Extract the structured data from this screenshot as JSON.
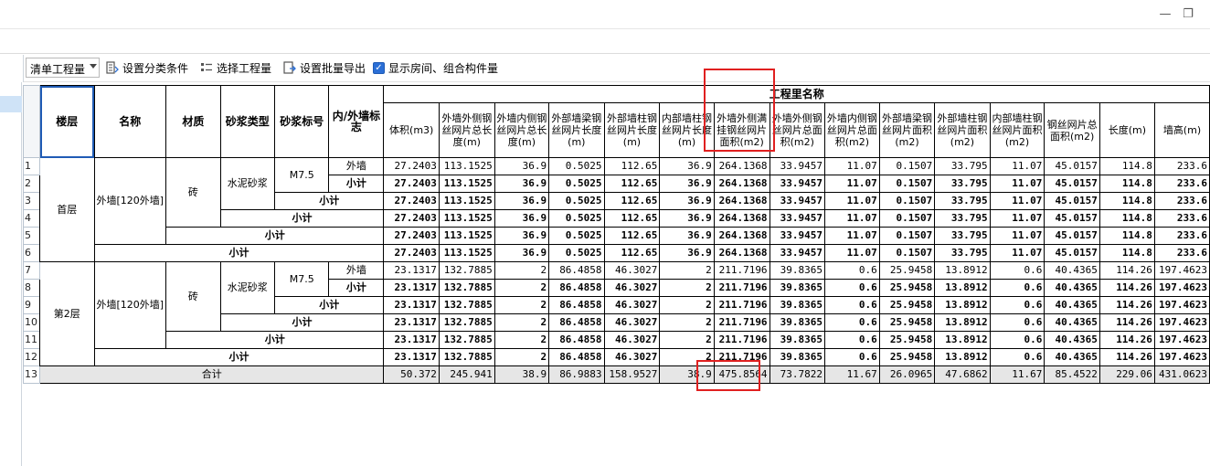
{
  "window": {
    "minimize_icon": "minimize-icon",
    "restore_icon": "restore-icon"
  },
  "toolbar": {
    "dropdown_value": "清单工程量",
    "group_label": "设置分类条件",
    "select_label": "选择工程量",
    "export_label": "设置批量导出",
    "show_label": "显示房间、组合构件量",
    "show_checked": true
  },
  "table": {
    "group_header": "工程里名称",
    "columns": {
      "floor": "楼层",
      "name": "名称",
      "material": "材质",
      "mortar_type": "砂浆类型",
      "mortar_grade": "砂浆标号",
      "inner_outer": "内/外墙标志",
      "volume": "体积(m3)",
      "c1": "外墙外侧钢丝网片总长度(m)",
      "c2": "外墙内侧钢丝网片总长度(m)",
      "c3": "外部墙梁钢丝网片长度(m)",
      "c4": "外部墙柱钢丝网片长度(m)",
      "c5": "内部墙柱钢丝网片长度(m)",
      "c6": "外墙外侧满挂钢丝网片面积(m2)",
      "c7": "外墙外侧钢丝网片总面积(m2)",
      "c8": "外墙内侧钢丝网片总面积(m2)",
      "c9": "外部墙梁钢丝网片面积(m2)",
      "c10": "外部墙柱钢丝网片面积(m2)",
      "c11": "内部墙柱钢丝网片面积(m2)",
      "c12": "钢丝网片总面积(m2)",
      "length": "长度(m)",
      "height": "墙高(m)"
    },
    "row_numbers": [
      "1",
      "2",
      "3",
      "4",
      "5",
      "6",
      "7",
      "8",
      "9",
      "10",
      "11",
      "12",
      "13"
    ],
    "floor1": {
      "floor": "首层",
      "name": "外墙[120外墙]",
      "material": "砖",
      "mortar_type": "水泥砂浆",
      "mortar_grade": "M7.5",
      "wall_flag": "外墙",
      "values": [
        "27.2403",
        "113.1525",
        "36.9",
        "0.5025",
        "112.65",
        "36.9",
        "264.1368",
        "33.9457",
        "11.07",
        "0.1507",
        "33.795",
        "11.07",
        "45.0157",
        "114.8",
        "233.6"
      ]
    },
    "floor2": {
      "floor": "第2层",
      "name": "外墙[120外墙]",
      "material": "砖",
      "mortar_type": "水泥砂浆",
      "mortar_grade": "M7.5",
      "wall_flag": "外墙",
      "values": [
        "23.1317",
        "132.7885",
        "2",
        "86.4858",
        "46.3027",
        "2",
        "211.7196",
        "39.8365",
        "0.6",
        "25.9458",
        "13.8912",
        "0.6",
        "40.4365",
        "114.26",
        "197.4623"
      ]
    },
    "subtotal_label": "小计",
    "total_label": "合计",
    "total_values": [
      "50.372",
      "245.941",
      "38.9",
      "86.9883",
      "158.9527",
      "38.9",
      "475.8564",
      "73.7822",
      "11.67",
      "26.0965",
      "47.6862",
      "11.67",
      "85.4522",
      "229.06",
      "431.0623"
    ]
  },
  "colors": {
    "annotation": "#e02020",
    "checkbox": "#2b6fd6",
    "selection": "#cfe3f7"
  }
}
